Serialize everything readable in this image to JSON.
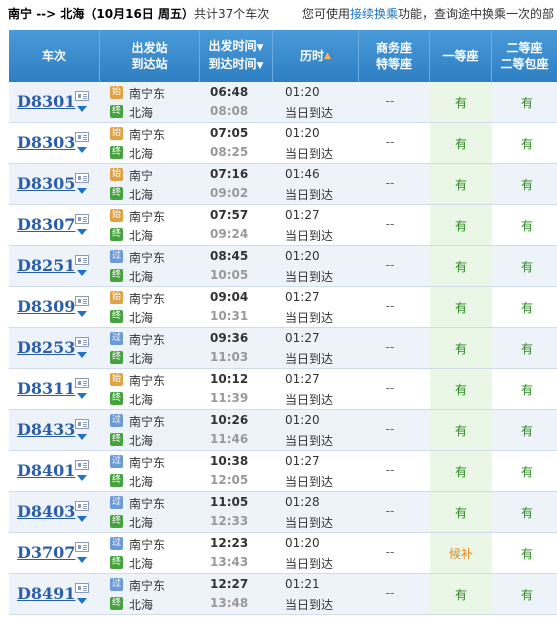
{
  "header": {
    "from": "南宁",
    "arrow": " --> ",
    "to": "北海",
    "date": "（10月16日  周五）",
    "count_text": "共计37个车次",
    "hint_prefix": "您可使用",
    "hint_link": "接续换乘",
    "hint_suffix": "功能，查询途中换乘一次的部"
  },
  "columns": {
    "train": "车次",
    "station_1": "出发站",
    "station_2": "到达站",
    "time_1": "出发时间",
    "time_2": "到达时间",
    "duration": "历时",
    "business_1": "商务座",
    "business_2": "特等座",
    "first": "一等座",
    "second_1": "二等座",
    "second_2": "二等包座"
  },
  "badges": {
    "start": "始",
    "pass": "过",
    "end": "终"
  },
  "rows": [
    {
      "train": "D8301",
      "from_type": "始",
      "from": "南宁东",
      "to": "北海",
      "dep": "06:48",
      "arr": "08:08",
      "dur": "01:20",
      "arrive_text": "当日到达",
      "business": "--",
      "first": "有",
      "second": "有"
    },
    {
      "train": "D8303",
      "from_type": "始",
      "from": "南宁东",
      "to": "北海",
      "dep": "07:05",
      "arr": "08:25",
      "dur": "01:20",
      "arrive_text": "当日到达",
      "business": "--",
      "first": "有",
      "second": "有"
    },
    {
      "train": "D8305",
      "from_type": "始",
      "from": "南宁",
      "to": "北海",
      "dep": "07:16",
      "arr": "09:02",
      "dur": "01:46",
      "arrive_text": "当日到达",
      "business": "--",
      "first": "有",
      "second": "有"
    },
    {
      "train": "D8307",
      "from_type": "始",
      "from": "南宁东",
      "to": "北海",
      "dep": "07:57",
      "arr": "09:24",
      "dur": "01:27",
      "arrive_text": "当日到达",
      "business": "--",
      "first": "有",
      "second": "有"
    },
    {
      "train": "D8251",
      "from_type": "过",
      "from": "南宁东",
      "to": "北海",
      "dep": "08:45",
      "arr": "10:05",
      "dur": "01:20",
      "arrive_text": "当日到达",
      "business": "--",
      "first": "有",
      "second": "有"
    },
    {
      "train": "D8309",
      "from_type": "始",
      "from": "南宁东",
      "to": "北海",
      "dep": "09:04",
      "arr": "10:31",
      "dur": "01:27",
      "arrive_text": "当日到达",
      "business": "--",
      "first": "有",
      "second": "有"
    },
    {
      "train": "D8253",
      "from_type": "过",
      "from": "南宁东",
      "to": "北海",
      "dep": "09:36",
      "arr": "11:03",
      "dur": "01:27",
      "arrive_text": "当日到达",
      "business": "--",
      "first": "有",
      "second": "有"
    },
    {
      "train": "D8311",
      "from_type": "始",
      "from": "南宁东",
      "to": "北海",
      "dep": "10:12",
      "arr": "11:39",
      "dur": "01:27",
      "arrive_text": "当日到达",
      "business": "--",
      "first": "有",
      "second": "有"
    },
    {
      "train": "D8433",
      "from_type": "过",
      "from": "南宁东",
      "to": "北海",
      "dep": "10:26",
      "arr": "11:46",
      "dur": "01:20",
      "arrive_text": "当日到达",
      "business": "--",
      "first": "有",
      "second": "有"
    },
    {
      "train": "D8401",
      "from_type": "过",
      "from": "南宁东",
      "to": "北海",
      "dep": "10:38",
      "arr": "12:05",
      "dur": "01:27",
      "arrive_text": "当日到达",
      "business": "--",
      "first": "有",
      "second": "有"
    },
    {
      "train": "D8403",
      "from_type": "过",
      "from": "南宁东",
      "to": "北海",
      "dep": "11:05",
      "arr": "12:33",
      "dur": "01:28",
      "arrive_text": "当日到达",
      "business": "--",
      "first": "有",
      "second": "有"
    },
    {
      "train": "D3707",
      "from_type": "过",
      "from": "南宁东",
      "to": "北海",
      "dep": "12:23",
      "arr": "13:43",
      "dur": "01:20",
      "arrive_text": "当日到达",
      "business": "--",
      "first": "候补",
      "second": "有"
    },
    {
      "train": "D8491",
      "from_type": "过",
      "from": "南宁东",
      "to": "北海",
      "dep": "12:27",
      "arr": "13:48",
      "dur": "01:21",
      "arrive_text": "当日到达",
      "business": "--",
      "first": "有",
      "second": "有"
    }
  ]
}
